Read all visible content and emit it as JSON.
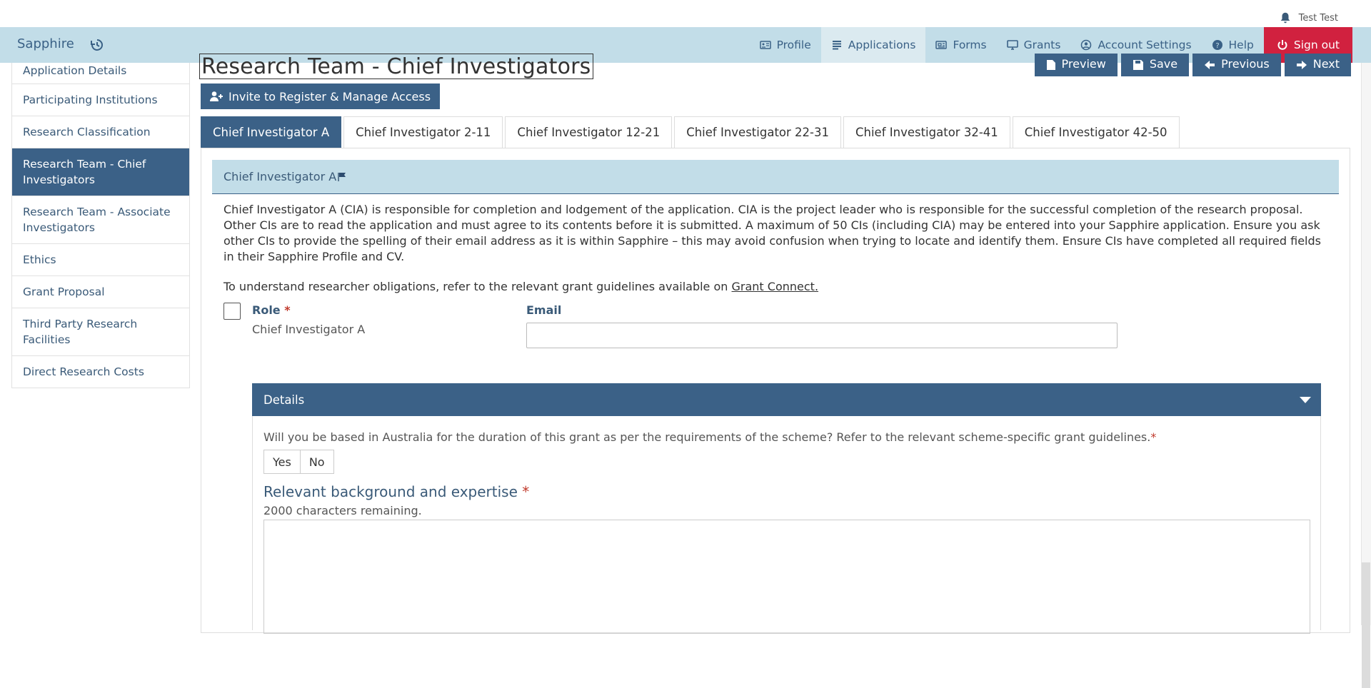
{
  "userbar": {
    "user_name": "Test Test",
    "icon": "bell-icon"
  },
  "nav": {
    "brand": "Sapphire",
    "items": [
      {
        "label": "Profile",
        "icon": "id-card-icon"
      },
      {
        "label": "Applications",
        "icon": "list-icon",
        "active": true
      },
      {
        "label": "Forms",
        "icon": "newspaper-icon"
      },
      {
        "label": "Grants",
        "icon": "monitor-icon"
      },
      {
        "label": "Account Settings",
        "icon": "user-circle-icon"
      },
      {
        "label": "Help",
        "icon": "question-icon"
      },
      {
        "label": "Sign out",
        "icon": "power-icon"
      }
    ]
  },
  "sidebar": {
    "items": [
      {
        "label": "Application Details"
      },
      {
        "label": "Participating Institutions"
      },
      {
        "label": "Research Classification"
      },
      {
        "label": "Research Team - Chief Investigators",
        "active": true
      },
      {
        "label": "Research Team - Associate Investigators"
      },
      {
        "label": "Ethics"
      },
      {
        "label": "Grant Proposal"
      },
      {
        "label": "Third Party Research Facilities"
      },
      {
        "label": "Direct Research Costs"
      }
    ]
  },
  "page": {
    "title": "Research Team - Chief Investigators",
    "buttons": {
      "preview": "Preview",
      "save": "Save",
      "previous": "Previous",
      "next": "Next"
    },
    "invite_label": "Invite to Register & Manage Access"
  },
  "tabs": [
    {
      "label": "Chief Investigator A",
      "active": true
    },
    {
      "label": "Chief Investigator 2-11"
    },
    {
      "label": "Chief Investigator 12-21"
    },
    {
      "label": "Chief Investigator 22-31"
    },
    {
      "label": "Chief Investigator 32-41"
    },
    {
      "label": "Chief Investigator 42-50"
    }
  ],
  "panel": {
    "heading": "Chief Investigator A",
    "description": "Chief Investigator A (CIA) is responsible for completion and lodgement of the application. CIA is the project leader who is responsible for the successful completion of the research proposal. Other CIs are to read the application and must agree to its contents before it is submitted. A maximum of 50 CIs (including CIA) may be entered into your Sapphire application. Ensure you ask other CIs to provide the spelling of their email address as it is within Sapphire – this may avoid confusion when trying to locate and identify them. Ensure CIs have completed all required fields in their Sapphire Profile and CV.",
    "obligations_text": "To understand researcher obligations, refer to the relevant grant guidelines available on ",
    "obligations_link": "Grant Connect.",
    "role_label": "Role",
    "required_mark": "*",
    "role_value": "Chief Investigator A",
    "email_label": "Email",
    "email_value": ""
  },
  "details": {
    "heading": "Details",
    "question": "Will you be based in Australia for the duration of this grant as per the requirements of the scheme? Refer to the relevant scheme-specific grant guidelines.",
    "yes_label": "Yes",
    "no_label": "No",
    "background_label": "Relevant background and expertise",
    "chars_remaining": "2000 characters remaining."
  },
  "colors": {
    "primary": "#3b6187",
    "nav_bg": "#c2dde8",
    "signout": "#d1213f",
    "required": "#c0392b"
  }
}
